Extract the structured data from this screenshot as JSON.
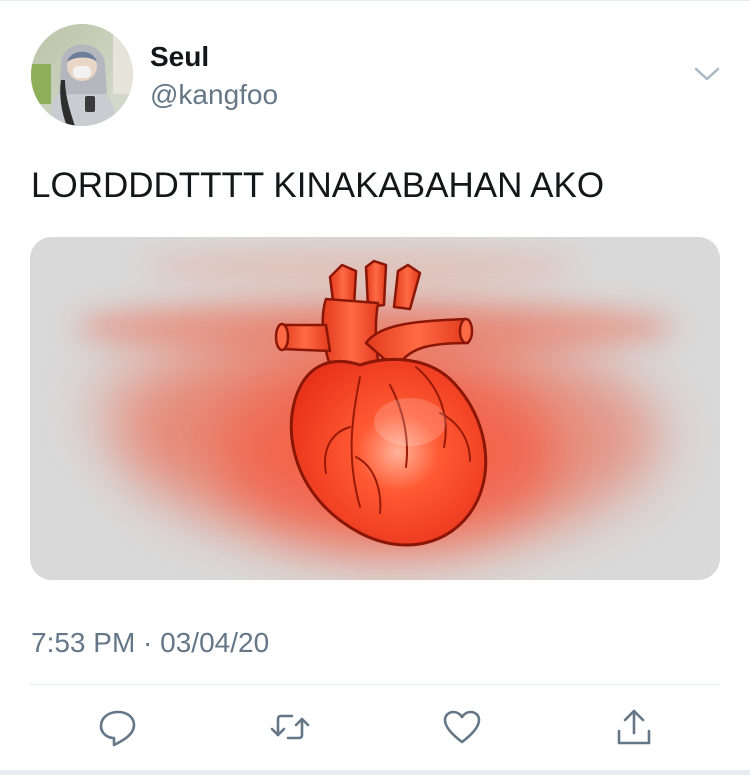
{
  "tweet": {
    "author": {
      "display_name": "Seul",
      "handle": "@kangfoo",
      "avatar_icon": "profile-photo"
    },
    "text": "LORDDDTTTT KINAKABAHAN AKO",
    "media": {
      "type": "image",
      "icon": "anatomical-heart-illustration"
    },
    "timestamp": "7:53 PM · 03/04/20",
    "menu_icon": "chevron-down-icon",
    "actions": [
      {
        "name": "reply",
        "icon": "speech-bubble-icon"
      },
      {
        "name": "retweet",
        "icon": "retweet-arrows-icon"
      },
      {
        "name": "like",
        "icon": "heart-outline-icon"
      },
      {
        "name": "share",
        "icon": "share-upload-icon"
      }
    ]
  },
  "colors": {
    "text_primary": "#14171a",
    "text_secondary": "#657786",
    "icon_gray": "#657786",
    "divider": "#e6ecf0",
    "heart_red": "#f03a1a"
  }
}
